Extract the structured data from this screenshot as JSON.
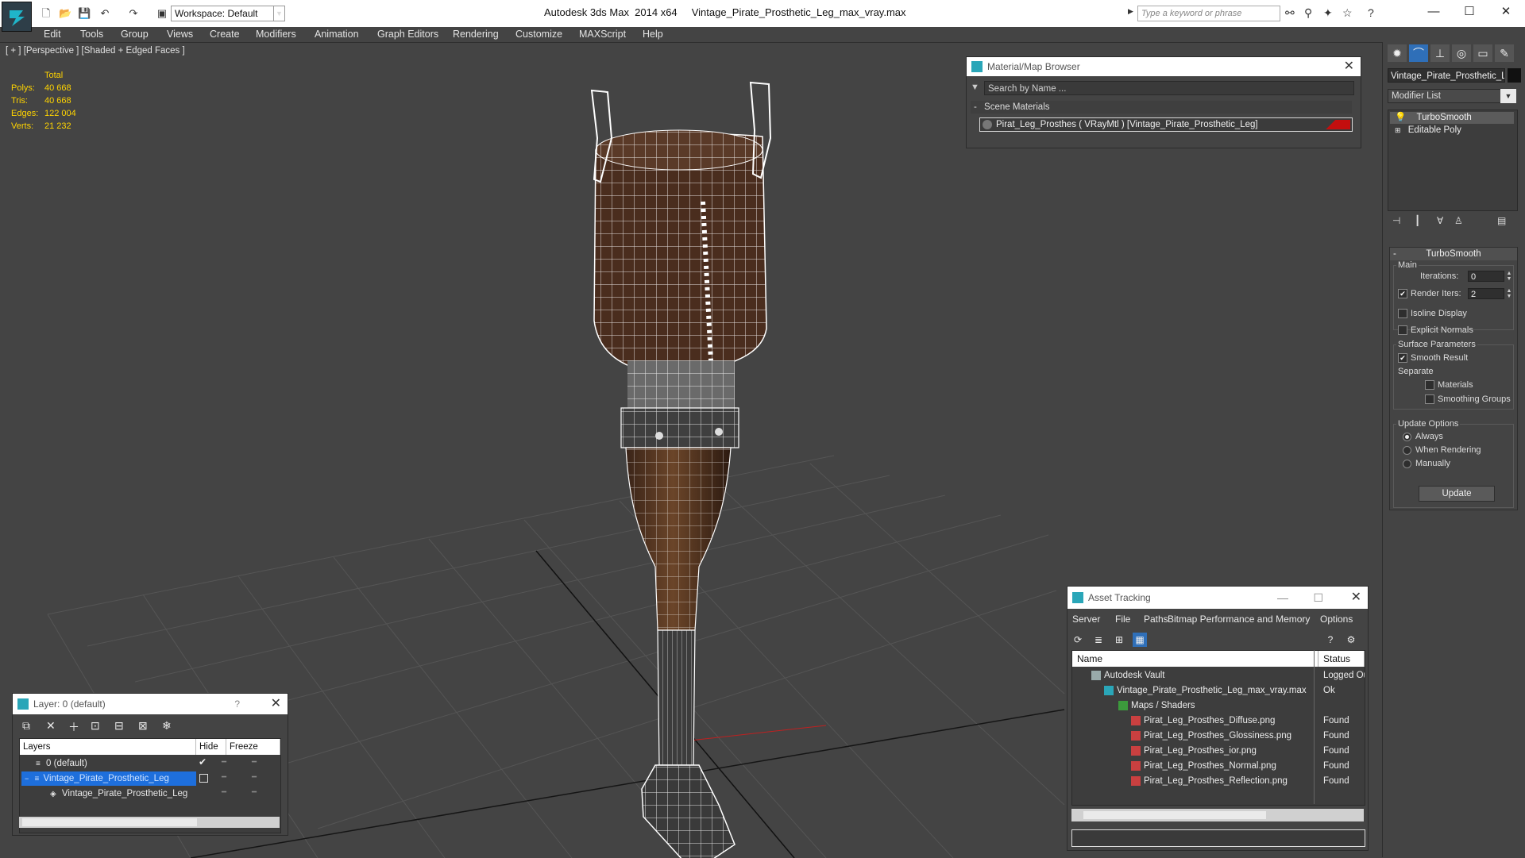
{
  "titlebar": {
    "workspace": "Workspace: Default",
    "title": "Autodesk 3ds Max  2014 x64     Vintage_Pirate_Prosthetic_Leg_max_vray.max",
    "search_placeholder": "Type a keyword or phrase",
    "minimize": "—",
    "maximize": "☐",
    "close": "✕"
  },
  "menu": [
    "Edit",
    "Tools",
    "Group",
    "Views",
    "Create",
    "Modifiers",
    "Animation",
    "Graph Editors",
    "Rendering",
    "Customize",
    "MAXScript",
    "Help"
  ],
  "viewport": {
    "label": "[ + ] [Perspective ] [Shaded + Edged Faces ]",
    "stats": {
      "header": "Total",
      "rows": [
        {
          "key": "Polys:",
          "value": "40 668"
        },
        {
          "key": "Tris:",
          "value": "40 668"
        },
        {
          "key": "Edges:",
          "value": "122 004"
        },
        {
          "key": "Verts:",
          "value": "21 232"
        }
      ]
    }
  },
  "material_browser": {
    "title": "Material/Map Browser",
    "search": "Search by Name ...",
    "group": "Scene Materials",
    "material": "Pirat_Leg_Prosthes  ( VRayMtl ) [Vintage_Pirate_Prosthetic_Leg]",
    "swatch_color": "#c30e0e"
  },
  "command_panel": {
    "object_name": "Vintage_Pirate_Prosthetic_Leg",
    "modifier_list": "Modifier List",
    "stack": [
      "TurboSmooth",
      "Editable Poly"
    ],
    "turbosmooth": {
      "title": "TurboSmooth",
      "main": "Main",
      "iterations_label": "Iterations:",
      "iterations": "0",
      "render_iters_label": "Render Iters:",
      "render_iters": "2",
      "isoline": "Isoline Display",
      "explicit_normals": "Explicit Normals",
      "surface_params": "Surface Parameters",
      "smooth_result": "Smooth Result",
      "separate": "Separate",
      "materials": "Materials",
      "smoothing_groups": "Smoothing Groups",
      "update_options": "Update Options",
      "always": "Always",
      "when_rendering": "When Rendering",
      "manually": "Manually",
      "update": "Update"
    }
  },
  "layer_panel": {
    "title": "Layer: 0 (default)",
    "help": "?",
    "close": "✕",
    "col_layers": "Layers",
    "col_hide": "Hide",
    "col_freeze": "Freeze",
    "rows": [
      "0 (default)",
      "Vintage_Pirate_Prosthetic_Leg",
      "Vintage_Pirate_Prosthetic_Leg"
    ]
  },
  "asset_tracking": {
    "title": "Asset Tracking",
    "menu": [
      "Server",
      "File",
      "Paths",
      "Bitmap Performance and Memory",
      "Options"
    ],
    "col_name": "Name",
    "col_status": "Status",
    "rows": [
      {
        "name": "Autodesk Vault",
        "status": "Logged Ou",
        "indent": 1
      },
      {
        "name": "Vintage_Pirate_Prosthetic_Leg_max_vray.max",
        "status": "Ok",
        "indent": 2
      },
      {
        "name": "Maps / Shaders",
        "status": "",
        "indent": 3
      },
      {
        "name": "Pirat_Leg_Prosthes_Diffuse.png",
        "status": "Found",
        "indent": 4
      },
      {
        "name": "Pirat_Leg_Prosthes_Glossiness.png",
        "status": "Found",
        "indent": 4
      },
      {
        "name": "Pirat_Leg_Prosthes_ior.png",
        "status": "Found",
        "indent": 4
      },
      {
        "name": "Pirat_Leg_Prosthes_Normal.png",
        "status": "Found",
        "indent": 4
      },
      {
        "name": "Pirat_Leg_Prosthes_Reflection.png",
        "status": "Found",
        "indent": 4
      }
    ]
  }
}
